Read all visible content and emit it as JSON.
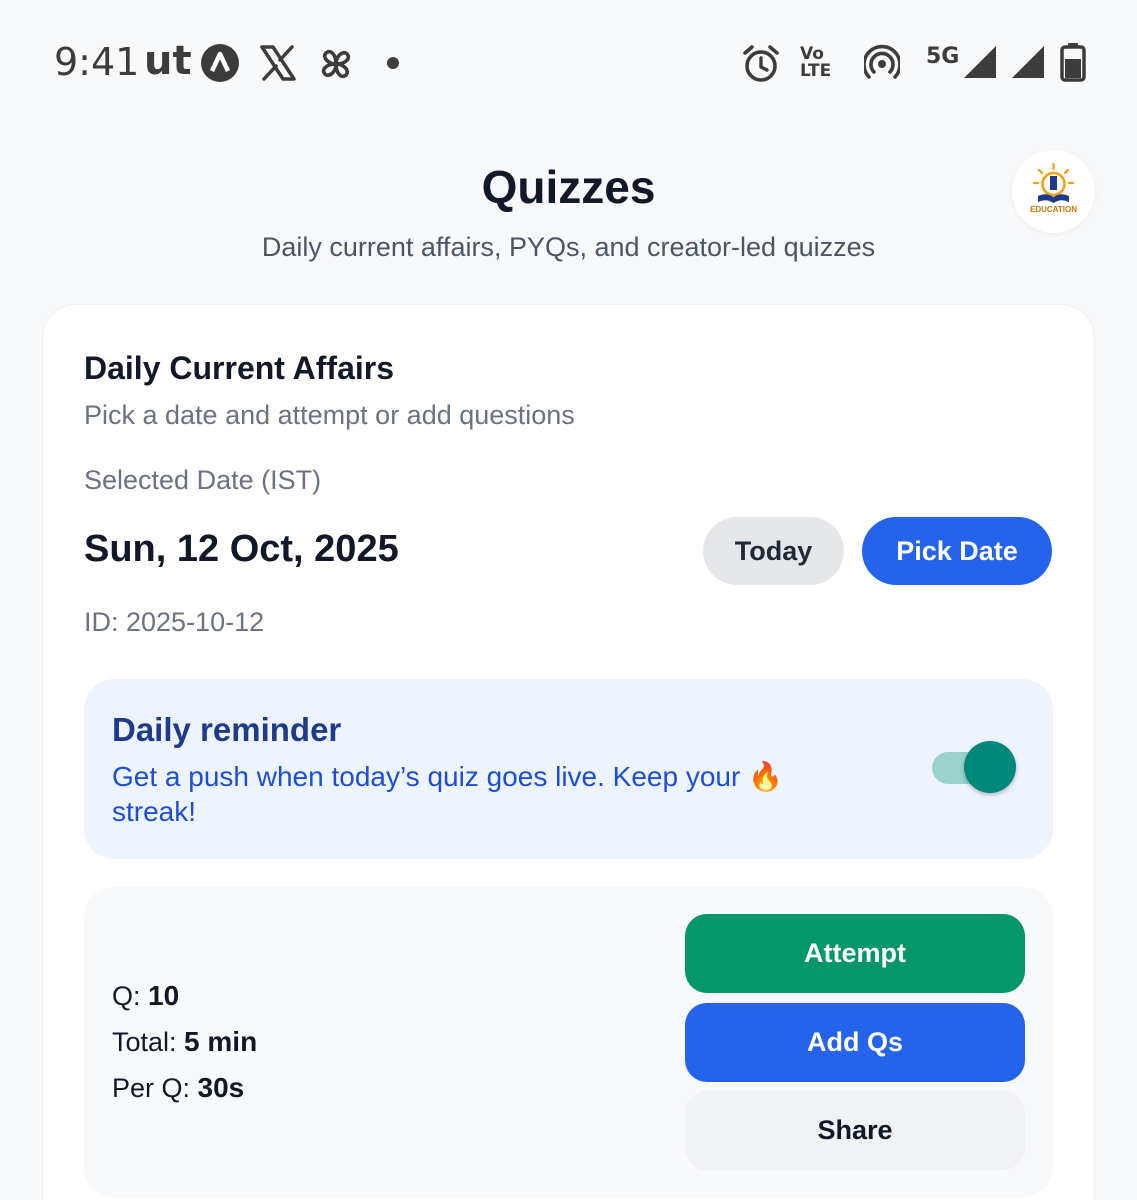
{
  "status_bar": {
    "time": "9:41",
    "carrier_glyph": "ut",
    "network": "5G",
    "volte_line1": "Vo",
    "volte_line2": "LTE",
    "icons": [
      "nav-app-icon",
      "x-icon",
      "pinwheel-icon",
      "dot-icon",
      "alarm-icon",
      "volte-icon",
      "hotspot-icon",
      "signal-icon",
      "signal-icon",
      "battery-icon"
    ]
  },
  "header": {
    "title": "Quizzes",
    "subtitle": "Daily current affairs, PYQs, and creator-led quizzes",
    "logo_text": "EDUCATION"
  },
  "daily": {
    "title": "Daily Current Affairs",
    "subtitle": "Pick a date and attempt or add questions",
    "date_label": "Selected Date (IST)",
    "date_value": "Sun, 12 Oct, 2025",
    "date_id": "ID: 2025-10-12",
    "today_label": "Today",
    "pick_date_label": "Pick Date"
  },
  "reminder": {
    "title": "Daily reminder",
    "description": "Get a push when today’s quiz goes live. Keep your 🔥 streak!",
    "enabled": true
  },
  "stats": {
    "questions_label": "Q: ",
    "questions_value": "10",
    "total_label": "Total: ",
    "total_value": "5 min",
    "per_label": "Per Q: ",
    "per_value": "30s"
  },
  "actions": {
    "attempt_label": "Attempt",
    "add_label": "Add Qs",
    "share_label": "Share"
  },
  "colors": {
    "primary": "#2563eb",
    "success": "#059669",
    "toggle_on": "#00897b",
    "reminder_bg": "#eef4fd"
  }
}
